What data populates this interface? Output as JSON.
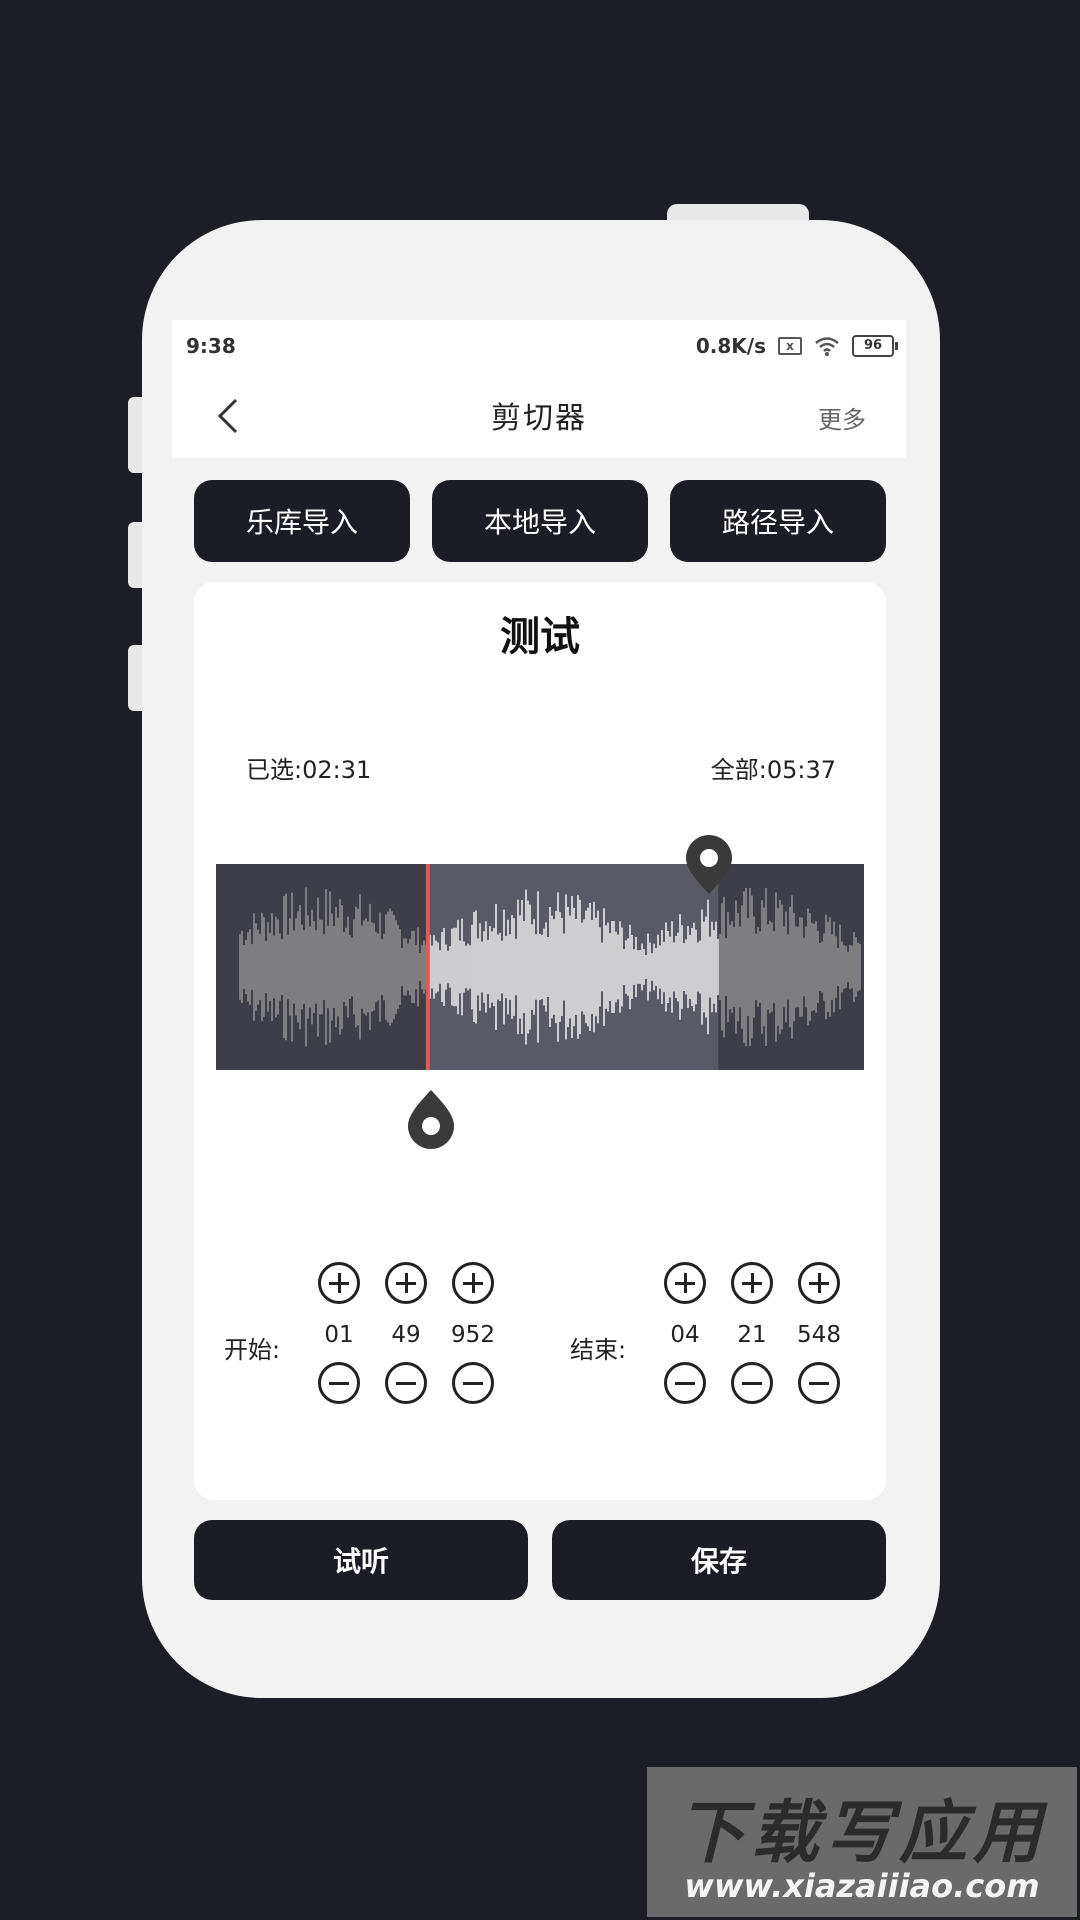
{
  "statusbar": {
    "time": "9:38",
    "network_speed": "0.8K/s",
    "sim": "x",
    "battery": "96"
  },
  "nav": {
    "title": "剪切器",
    "more": "更多"
  },
  "import_buttons": [
    "乐库导入",
    "本地导入",
    "路径导入"
  ],
  "card": {
    "title": "测试",
    "selected": "已选:02:31",
    "total": "全部:05:37"
  },
  "start": {
    "label": "开始:",
    "values": [
      "01",
      "49",
      "952"
    ]
  },
  "end": {
    "label": "结束:",
    "values": [
      "04",
      "21",
      "548"
    ]
  },
  "bottom": {
    "preview": "试听",
    "save": "保存"
  },
  "waveform": {
    "selection_start_fraction": 0.327,
    "selection_end_fraction": 0.775,
    "colors": {
      "bg": "#3e3e48",
      "selected_bg": "#5a5a66",
      "wave": "#9a9a9a",
      "selected_wave": "#ffffff",
      "playhead": "#e05a5a"
    }
  },
  "watermark": {
    "text": "下载写应用",
    "url": "www.xiazaiiiao.com"
  }
}
